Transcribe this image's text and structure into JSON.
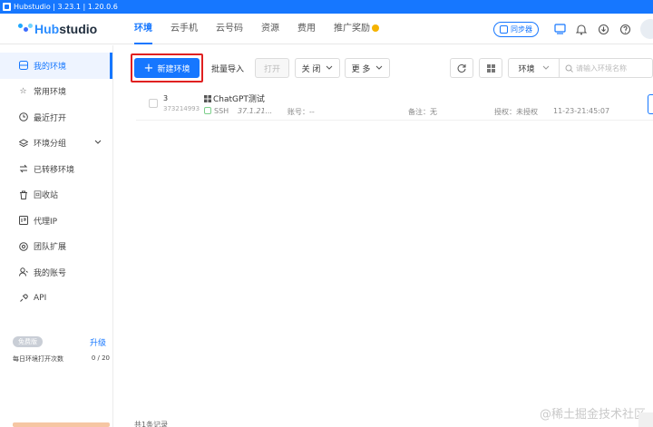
{
  "window": {
    "title": "Hubstudio | 3.23.1 | 1.20.0.6"
  },
  "brand": {
    "name_a": "Hub",
    "name_b": "studio"
  },
  "nav": [
    {
      "label": "环境",
      "active": true
    },
    {
      "label": "云手机"
    },
    {
      "label": "云号码"
    },
    {
      "label": "资源"
    },
    {
      "label": "费用"
    },
    {
      "label": "推广奖励"
    }
  ],
  "topright": {
    "sync_label": "同步器"
  },
  "sidebar": {
    "items": [
      {
        "label": "我的环境",
        "icon": "environment-icon",
        "active": true
      },
      {
        "label": "常用环境",
        "icon": "star-icon"
      },
      {
        "label": "最近打开",
        "icon": "clock-icon"
      },
      {
        "label": "环境分组",
        "icon": "layers-icon",
        "expand": true
      },
      {
        "label": "已转移环境",
        "icon": "transfer-icon"
      },
      {
        "label": "回收站",
        "icon": "trash-icon"
      },
      {
        "label": "代理IP",
        "icon": "proxy-icon"
      },
      {
        "label": "团队扩展",
        "icon": "team-icon"
      },
      {
        "label": "我的账号",
        "icon": "user-icon"
      },
      {
        "label": "API",
        "icon": "api-icon"
      }
    ],
    "plan": {
      "tag": "免费版",
      "upgrade": "升级",
      "daily_label": "每日环境打开次数",
      "daily_value": "0 / 20"
    }
  },
  "toolbar": {
    "new_env": "新建环境",
    "batch_import": "批量导入",
    "open": "打开",
    "close": "关 闭",
    "more": "更 多",
    "filter_select": "环境",
    "search_placeholder": "请输入环境名称"
  },
  "table": {
    "rows": [
      {
        "index": "3",
        "id": "373214993",
        "name": "ChatGPT测试",
        "protocol": "SSH",
        "ip": "37.1.21...",
        "account_label": "账号：--",
        "remark_label": "备注：无",
        "auth_label": "授权：未授权",
        "time": "11-23-21:45:07"
      }
    ]
  },
  "footer": {
    "count": "共1条记录"
  },
  "watermark": "@稀土掘金技术社区",
  "colors": {
    "primary": "#1677ff",
    "highlight": "#e02020",
    "reward_dot": "#f5b301"
  }
}
